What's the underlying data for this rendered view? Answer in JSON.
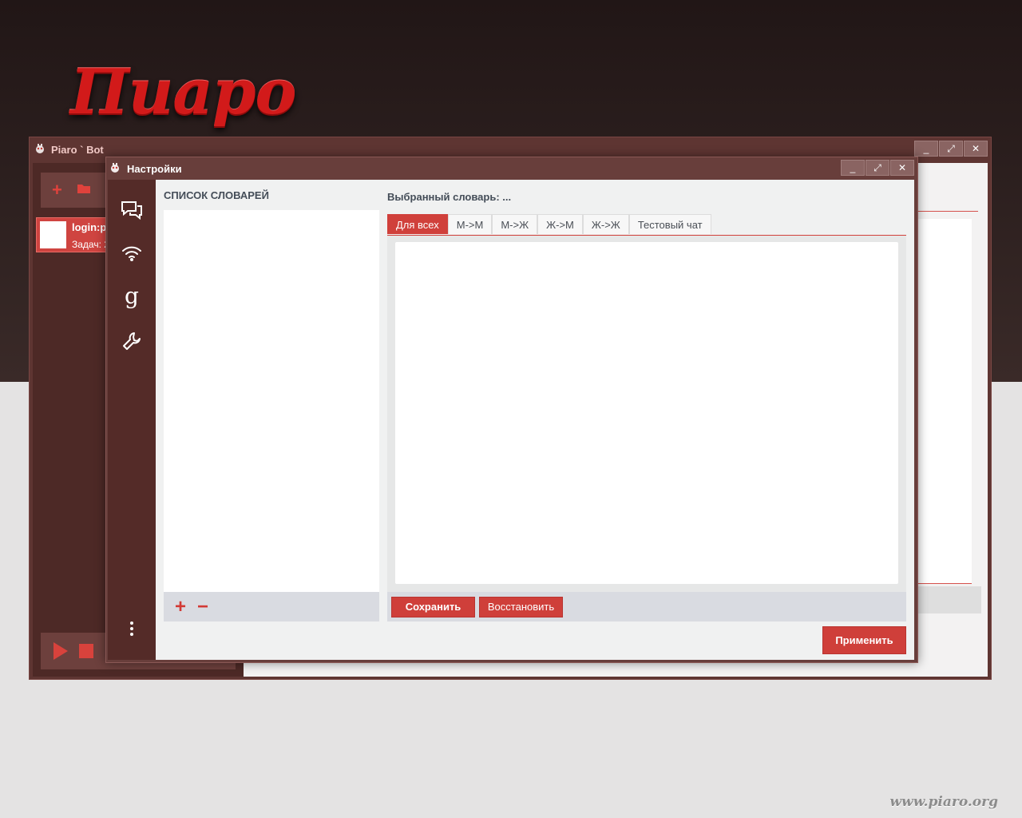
{
  "background": {
    "logo_text": "Пиаро",
    "watermark": "www.piaro.org"
  },
  "main_window": {
    "title": "Piaro ` Bot",
    "controls": {
      "minimize": "_",
      "maximize": "⤢",
      "close": "✕"
    },
    "account": {
      "login": "login:p",
      "tasks": "Задач: 2"
    }
  },
  "settings_dialog": {
    "title": "Настройки",
    "controls": {
      "minimize": "_",
      "maximize": "⤢",
      "close": "✕"
    },
    "sidebar_icons": [
      "chat-icon",
      "wifi-icon",
      "google-icon",
      "wrench-icon",
      "more-icon"
    ],
    "dictionaries": {
      "title": "СПИСОК СЛОВАРЕЙ",
      "add": "+",
      "remove": "−"
    },
    "selected": {
      "title": "Выбранный словарь: ...",
      "tabs": [
        "Для всех",
        "М->М",
        "М->Ж",
        "Ж->М",
        "Ж->Ж",
        "Тестовый чат"
      ],
      "active_tab": 0,
      "save_label": "Сохранить",
      "restore_label": "Восстановить"
    },
    "apply_label": "Применить"
  },
  "colors": {
    "accent": "#cf3f3a",
    "dark_brown": "#542b28",
    "window_brown": "#683e3b"
  }
}
